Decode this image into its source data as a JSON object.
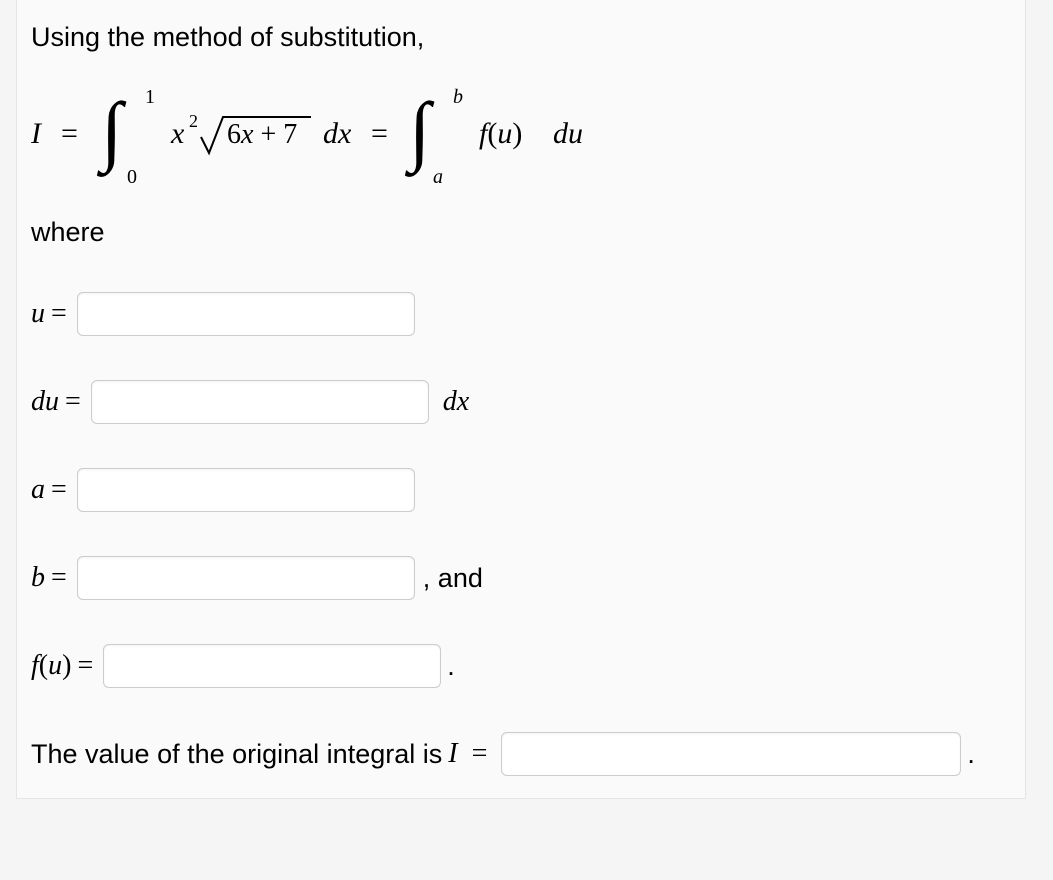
{
  "intro": "Using the method of substitution,",
  "where": "where",
  "labels": {
    "u": "u",
    "du": "du",
    "a": "a",
    "b": "b",
    "fu": "f(u)",
    "eq": "="
  },
  "trailers": {
    "dx": "dx",
    "and": ", and",
    "dot": "."
  },
  "final": {
    "text": "The value of the original integral is ",
    "var": "I",
    "eq": "="
  },
  "equation": {
    "I": "I",
    "eq1": "=",
    "int_low1": "0",
    "int_high1": "1",
    "integrand_x2": "x",
    "integrand_sq": "2",
    "rad": "6x + 7",
    "dx": "dx",
    "eq2": "=",
    "int_low2": "a",
    "int_high2": "b",
    "fu": "f(u)",
    "du": "du"
  },
  "inputs": {
    "u": "",
    "du": "",
    "a": "",
    "b": "",
    "fu": "",
    "I": ""
  }
}
